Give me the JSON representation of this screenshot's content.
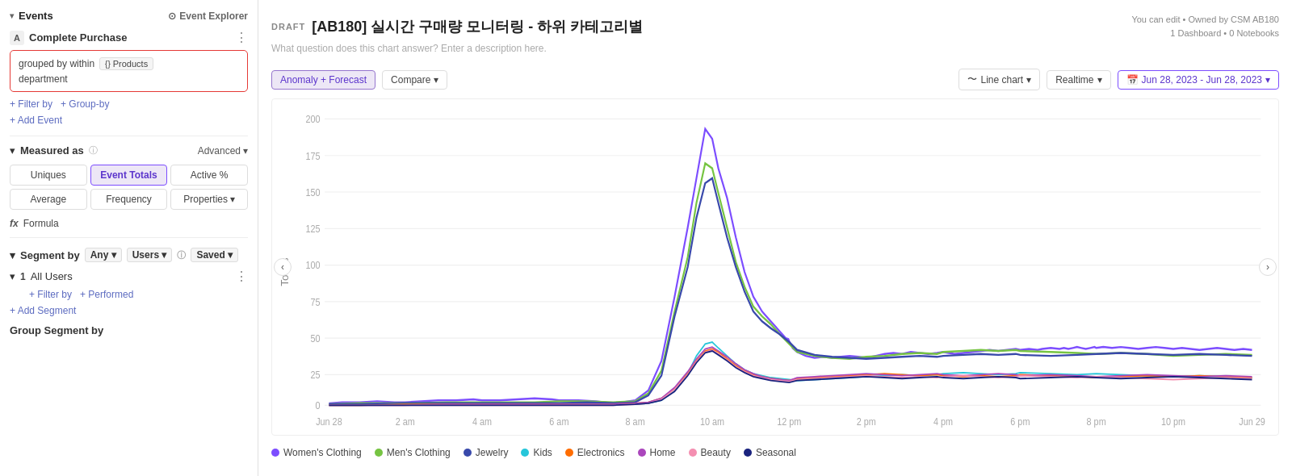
{
  "leftPanel": {
    "events": {
      "sectionLabel": "Events",
      "explorerBtn": "Event Explorer",
      "eventLetter": "A",
      "eventName": "Complete Purchase",
      "groupedBy": "grouped by within",
      "productsBadge": "Products",
      "department": "department",
      "filterBy": "+ Filter by",
      "groupBy": "+ Group-by",
      "addEvent": "+ Add Event"
    },
    "measuredAs": {
      "sectionLabel": "Measured as",
      "badge": "Advanced",
      "tab1": "Uniques",
      "tab2": "Event Totals",
      "tab3": "Active %",
      "tab4": "Average",
      "tab5": "Frequency",
      "tab6": "Properties",
      "formula": "Formula"
    },
    "segmentBy": {
      "sectionLabel": "Segment by",
      "any": "Any",
      "users": "Users",
      "saved": "Saved",
      "segNum": "1",
      "segName": "All Users",
      "filterBy": "+ Filter by",
      "performed": "+ Performed",
      "addSegment": "+ Add Segment",
      "groupSegment": "Group Segment by"
    }
  },
  "rightPanel": {
    "draftBadge": "DRAFT",
    "chartTitle": "[AB180] 실시간 구매량 모니터링 - 하위 카테고리별",
    "topRightInfo": "You can edit • Owned by CSM AB180\n1 Dashboard • 0 Notebooks",
    "chartDesc": "What question does this chart answer? Enter a description here.",
    "anomalyBtn": "Anomaly + Forecast",
    "compareBtn": "Compare",
    "lineChartBtn": "Line chart",
    "realtimeBtn": "Realtime",
    "dateRange": "Jun 28, 2023 - Jun 28, 2023",
    "yAxisLabel": "Totals",
    "yAxisValues": [
      "200",
      "175",
      "150",
      "125",
      "100",
      "75",
      "50",
      "25",
      "0"
    ],
    "xAxisLabels": [
      "Jun 28",
      "2 am",
      "4 am",
      "6 am",
      "8 am",
      "10 am",
      "12 pm",
      "2 pm",
      "4 pm",
      "6 pm",
      "8 pm",
      "10 pm",
      "Jun 29"
    ],
    "legend": [
      {
        "label": "Women's Clothing",
        "color": "#7c4dff"
      },
      {
        "label": "Men's Clothing",
        "color": "#76c442"
      },
      {
        "label": "Jewelry",
        "color": "#3949ab"
      },
      {
        "label": "Kids",
        "color": "#26c6da"
      },
      {
        "label": "Electronics",
        "color": "#ff6d00"
      },
      {
        "label": "Home",
        "color": "#ab47bc"
      },
      {
        "label": "Beauty",
        "color": "#f48fb1"
      },
      {
        "label": "Seasonal",
        "color": "#1a237e"
      }
    ]
  }
}
